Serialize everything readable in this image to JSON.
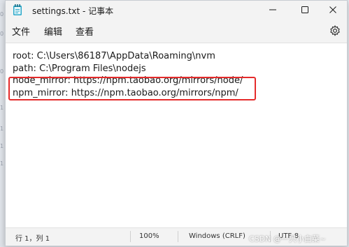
{
  "window": {
    "title": "settings.txt - 记事本",
    "icons": {
      "app": "notepad-icon",
      "minimize": "minimize-icon",
      "maximize": "maximize-icon",
      "close": "close-icon"
    }
  },
  "menu": {
    "items": [
      "文件",
      "编辑",
      "查看"
    ],
    "settings_icon": "gear-icon"
  },
  "editor": {
    "lines": [
      "root: C:\\Users\\86187\\AppData\\Roaming\\nvm",
      "path: C:\\Program Files\\nodejs",
      "node_mirror: https://npm.taobao.org/mirrors/node/",
      "npm_mirror: https://npm.taobao.org/mirrors/npm/"
    ],
    "highlight_color": "#e52b2b"
  },
  "status": {
    "position": "行 1，列 1",
    "zoom": "100%",
    "line_ending": "Windows (CRLF)",
    "encoding": "UTF-8"
  },
  "watermark": "CSDN @一只小白菜~"
}
